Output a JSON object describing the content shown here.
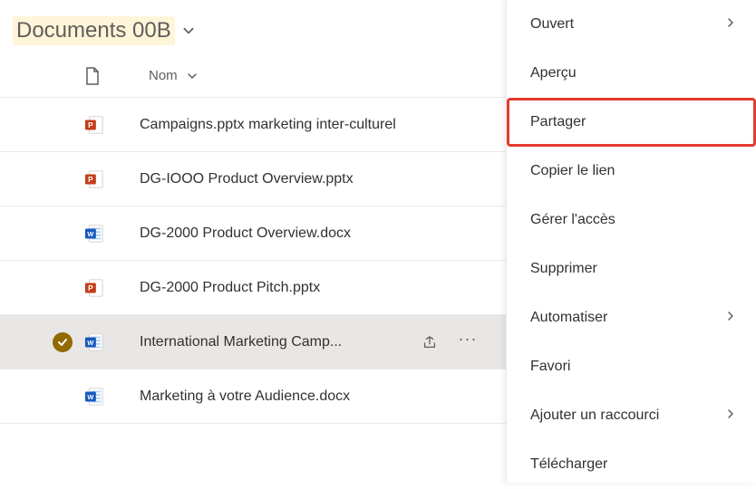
{
  "header": {
    "title": "Documents 00B"
  },
  "columns": {
    "name": "Nom"
  },
  "files": [
    {
      "icon": "pptx",
      "name": "Campaigns.pptx marketing inter-culturel",
      "selected": false
    },
    {
      "icon": "pptx",
      "name": "DG-IOOO Product Overview.pptx",
      "selected": false
    },
    {
      "icon": "docx",
      "name": "DG-2000 Product Overview.docx",
      "selected": false
    },
    {
      "icon": "pptx",
      "name": "DG-2000 Product Pitch.pptx",
      "selected": false
    },
    {
      "icon": "docx",
      "name": "International Marketing Camp...",
      "selected": true
    },
    {
      "icon": "docx",
      "name": "Marketing à votre Audience.docx",
      "selected": false
    }
  ],
  "menu": {
    "open": "Ouvert",
    "preview": "Aperçu",
    "share": "Partager",
    "copy_link": "Copier le lien",
    "manage_access": "Gérer l'accès",
    "delete": "Supprimer",
    "automate": "Automatiser",
    "favorite": "Favori",
    "add_shortcut": "Ajouter un raccourci",
    "download": "Télécharger"
  },
  "highlighted_menu_item": "share"
}
